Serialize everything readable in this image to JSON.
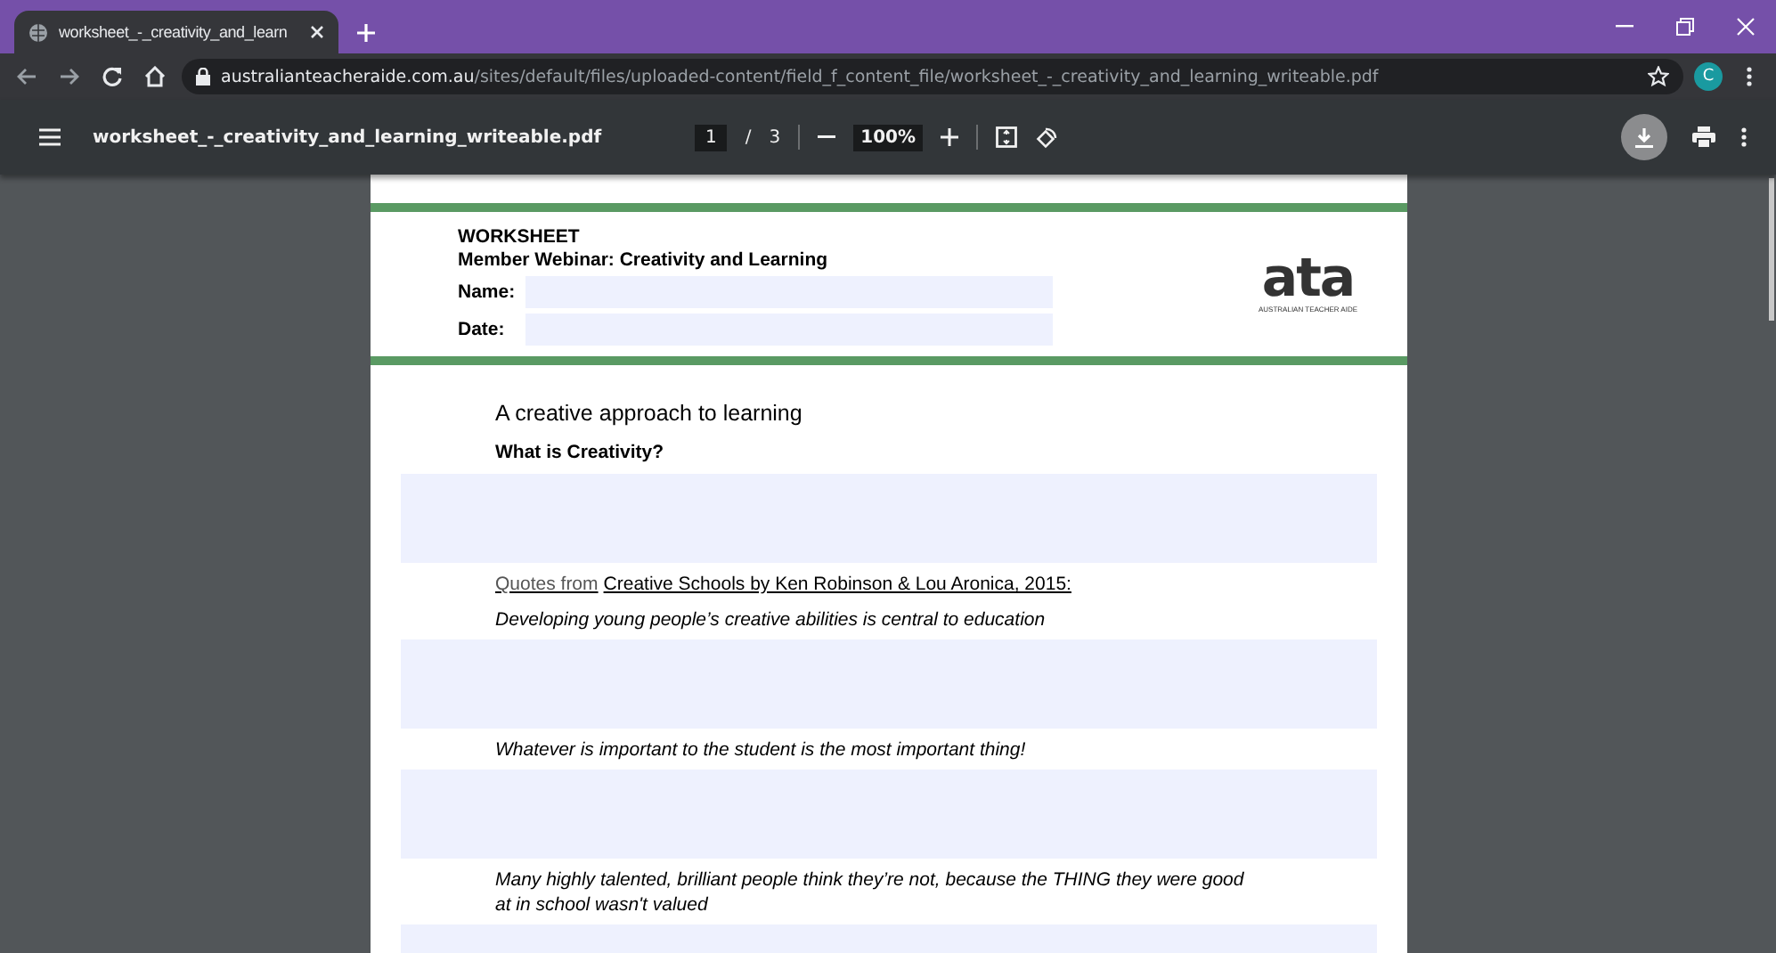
{
  "tab": {
    "title": "worksheet_-_creativity_and_learn",
    "selected": true
  },
  "address": {
    "host": "australianteacheraide.com.au",
    "path": "/sites/default/files/uploaded-content/field_f_content_file/worksheet_-_creativity_and_learning_writeable.pdf"
  },
  "profile": {
    "initial": "C"
  },
  "viewer": {
    "file_name": "worksheet_-_creativity_and_learning_writeable.pdf",
    "page": "1",
    "page_separator": "/",
    "page_count": "3",
    "zoom": "100%"
  },
  "document": {
    "header": {
      "label": "WORKSHEET",
      "subtitle": "Member Webinar: Creativity and Learning",
      "fields": [
        {
          "label": "Name:"
        },
        {
          "label": "Date:"
        }
      ],
      "logo": {
        "mark": "ata",
        "caption": "AUSTRALIAN TEACHER AIDE"
      }
    },
    "body": [
      {
        "kind": "heading",
        "text": "A creative approach to learning"
      },
      {
        "kind": "subheading",
        "text": "What is Creativity?"
      },
      {
        "kind": "answer"
      },
      {
        "kind": "citation",
        "prefix": "Quotes from",
        "text": "Creative Schools by Ken Robinson & Lou Aronica, 2015:"
      },
      {
        "kind": "quote",
        "text": "Developing young people’s creative abilities is central to education"
      },
      {
        "kind": "answer"
      },
      {
        "kind": "quote",
        "text": "Whatever is important to the student is the most important thing!"
      },
      {
        "kind": "answer"
      },
      {
        "kind": "quote",
        "text": "Many highly talented, brilliant people think they’re not, because the THING they were good at in school wasn't valued"
      },
      {
        "kind": "answer"
      }
    ]
  }
}
